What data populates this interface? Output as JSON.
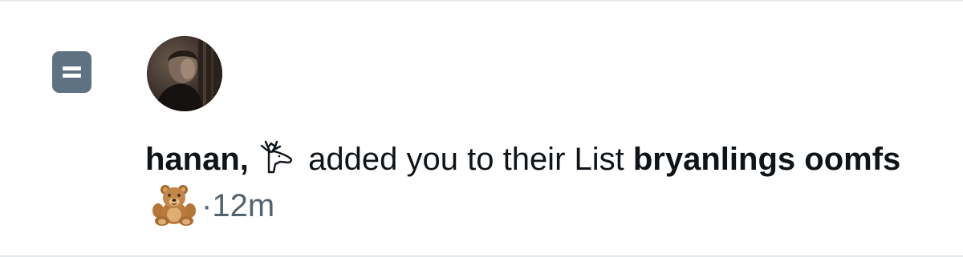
{
  "notification": {
    "icon": "list-icon",
    "avatar": "user-avatar",
    "user_name": "hanan,",
    "name_emoji": "deer-icon",
    "action_text": "added you to their List",
    "list_name_part1": "bryanlings",
    "list_name_part2": "oomfs",
    "list_emoji": "teddy-bear-emoji",
    "separator": "·",
    "timestamp": "12m"
  },
  "colors": {
    "list_icon_bg": "#5e7283",
    "text": "#0f1419",
    "secondary_text": "#536471",
    "border": "#e6e9ec"
  }
}
